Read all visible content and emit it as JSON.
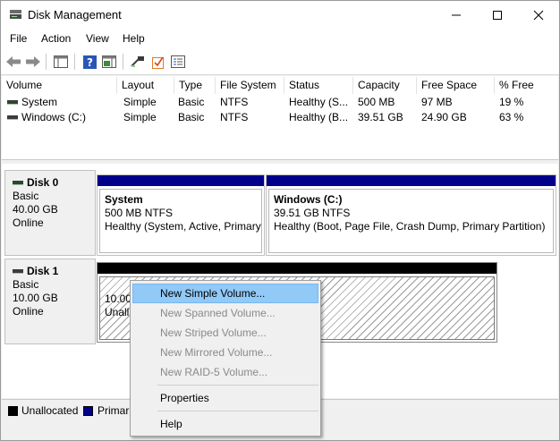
{
  "window": {
    "title": "Disk Management"
  },
  "menu": [
    "File",
    "Action",
    "View",
    "Help"
  ],
  "list": {
    "columns": [
      "Volume",
      "Layout",
      "Type",
      "File System",
      "Status",
      "Capacity",
      "Free Space",
      "% Free"
    ],
    "rows": [
      [
        "System",
        "Simple",
        "Basic",
        "NTFS",
        "Healthy (S...",
        "500 MB",
        "97 MB",
        "19 %"
      ],
      [
        "Windows (C:)",
        "Simple",
        "Basic",
        "NTFS",
        "Healthy (B...",
        "39.51 GB",
        "24.90 GB",
        "63 %"
      ]
    ]
  },
  "disks": [
    {
      "name": "Disk 0",
      "type": "Basic",
      "size": "40.00 GB",
      "status": "Online",
      "partitions": [
        {
          "name": "System",
          "size": "500 MB NTFS",
          "status": "Healthy (System, Active, Primary"
        },
        {
          "name": "Windows  (C:)",
          "size": "39.51 GB NTFS",
          "status": "Healthy (Boot, Page File, Crash Dump, Primary Partition)"
        }
      ]
    },
    {
      "name": "Disk 1",
      "type": "Basic",
      "size": "10.00 GB",
      "status": "Online",
      "partitions": [
        {
          "size": "10.00",
          "status": "Unall"
        }
      ]
    }
  ],
  "legend": {
    "unallocated": "Unallocated",
    "primary": "Primar"
  },
  "context_menu": {
    "items": [
      "New Simple Volume...",
      "New Spanned Volume...",
      "New Striped Volume...",
      "New Mirrored Volume...",
      "New RAID-5 Volume...",
      "Properties",
      "Help"
    ]
  },
  "colors": {
    "primary": "#00008b",
    "unallocated": "#000000",
    "highlight": "#91c9f7"
  }
}
